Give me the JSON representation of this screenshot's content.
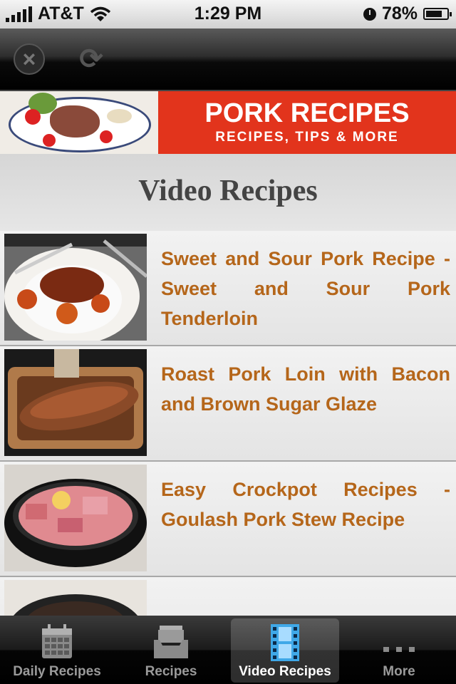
{
  "status_bar": {
    "carrier": "AT&T",
    "time": "1:29 PM",
    "battery": "78%",
    "battery_level": 0.78,
    "icons": [
      "signal-bars-icon",
      "wifi-icon",
      "clock-icon",
      "battery-icon"
    ]
  },
  "toolbar": {
    "close_icon": "close-icon",
    "refresh_icon": "refresh-icon"
  },
  "banner": {
    "title": "PORK RECIPES",
    "subtitle": "RECIPES, TIPS & MORE",
    "accent_color": "#e2341c"
  },
  "header": {
    "title": "Video Recipes"
  },
  "list": {
    "title_color": "#b5661a",
    "items": [
      {
        "title": "Sweet and Sour Pork Recipe - Sweet and Sour Pork Tenderloin"
      },
      {
        "title": "Roast Pork Loin with Bacon and Brown Sugar Glaze"
      },
      {
        "title": "Easy Crockpot Recipes - Goulash Pork Stew Recipe"
      },
      {
        "title": ""
      }
    ]
  },
  "tab_bar": {
    "tabs": [
      {
        "label": "Daily Recipes",
        "icon": "calendar-icon",
        "active": false
      },
      {
        "label": "Recipes",
        "icon": "inbox-tray-icon",
        "active": false
      },
      {
        "label": "Video Recipes",
        "icon": "film-icon",
        "active": true
      },
      {
        "label": "More",
        "icon": "more-dots-icon",
        "active": false
      }
    ]
  }
}
